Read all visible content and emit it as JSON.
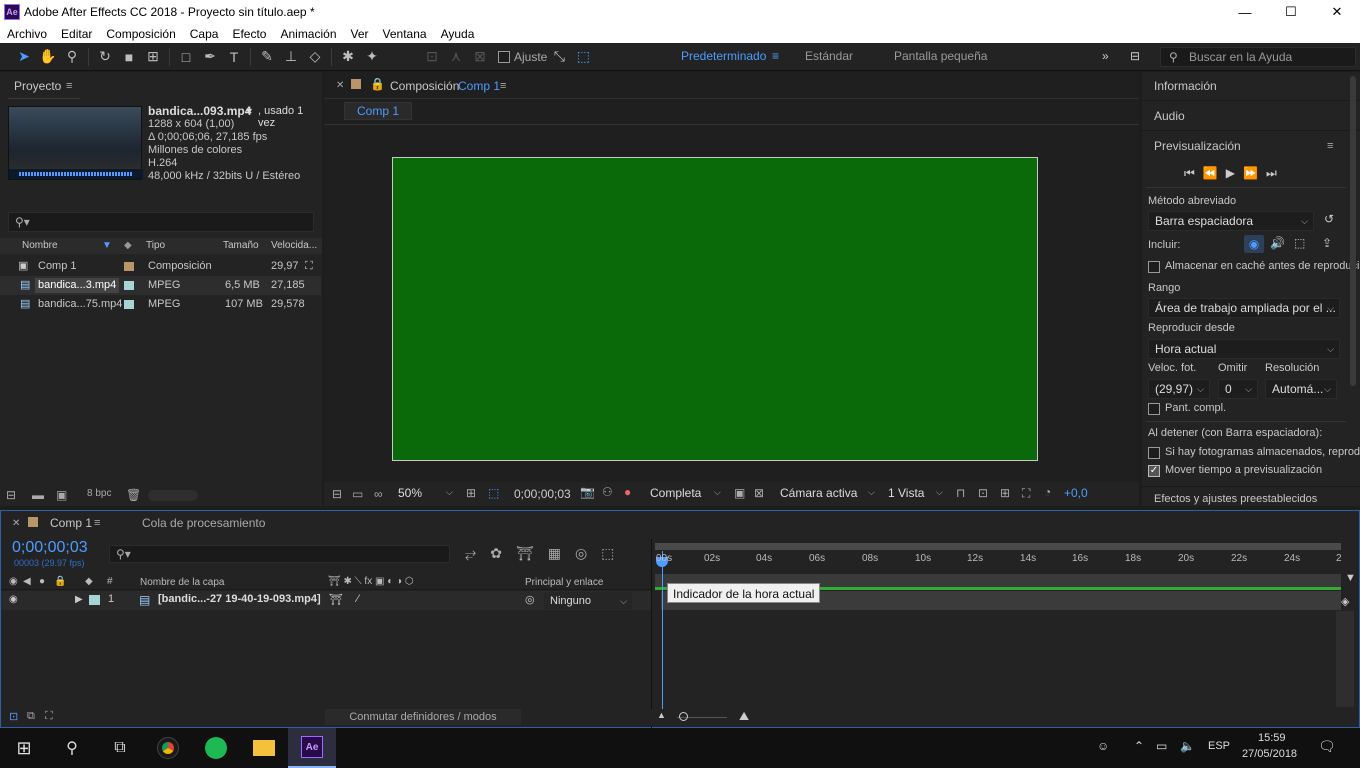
{
  "window": {
    "title": "Adobe After Effects CC 2018 - Proyecto sin título.aep *",
    "logo": "Ae",
    "minimize": "—",
    "maximize": "☐",
    "close": "✕"
  },
  "menu": [
    "Archivo",
    "Editar",
    "Composición",
    "Capa",
    "Efecto",
    "Animación",
    "Ver",
    "Ventana",
    "Ayuda"
  ],
  "toolbar": {
    "snap_label": "Ajuste",
    "workspaces": [
      "Predeterminado",
      "Estándar",
      "Pantalla pequeña"
    ],
    "help_placeholder": "Buscar en la Ayuda"
  },
  "project": {
    "title": "Proyecto",
    "footage": {
      "name": "bandica...093.mp4",
      "usage": ", usado 1 vez",
      "dims": "1288 x 604 (1,00)",
      "duration": "Δ 0;00;06;06, 27,185 fps",
      "colors": "Millones de colores",
      "codec": "H.264",
      "audio": "48,000 kHz / 32bits U / Estéreo"
    },
    "columns": [
      "Nombre",
      "Tipo",
      "Tamaño",
      "Velocida..."
    ],
    "items": [
      {
        "name": "Comp 1",
        "type": "Composición",
        "size": "",
        "rate": "29,97",
        "color": "#b99669"
      },
      {
        "name": "bandica...3.mp4",
        "type": "MPEG",
        "size": "6,5 MB",
        "rate": "27,185",
        "color": "#a7d4d4"
      },
      {
        "name": "bandica...75.mp4",
        "type": "MPEG",
        "size": "107 MB",
        "rate": "29,578",
        "color": "#a7d4d4"
      }
    ],
    "bpc": "8 bpc"
  },
  "composition": {
    "label": "Composición",
    "name": "Comp 1",
    "tab": "Comp 1",
    "canvas_color": "#0a6a0a",
    "zoom": "50%",
    "timecode": "0;00;00;03",
    "quality": "Completa",
    "camera": "Cámara activa",
    "views": "1 Vista",
    "exposure": "+0,0"
  },
  "right_panel": {
    "info": "Información",
    "audio": "Audio",
    "preview": "Previsualización",
    "shortcut_label": "Método abreviado",
    "shortcut_value": "Barra espaciadora",
    "include_label": "Incluir:",
    "cache_label": "Almacenar en caché antes de reproducir",
    "range_label": "Rango",
    "range_value": "Área de trabajo ampliada por el ...",
    "play_from_label": "Reproducir desde",
    "play_from_value": "Hora actual",
    "fps_label": "Veloc. fot.",
    "skip_label": "Omitir",
    "res_label": "Resolución",
    "fps_value": "(29,97)",
    "skip_value": "0",
    "res_value": "Automá...",
    "fullscreen_label": "Pant. compl.",
    "on_stop_label": "Al detener (con Barra espaciadora):",
    "cached_label": "Si hay fotogramas almacenados, reproducir",
    "move_time_label": "Mover tiempo a previsualización",
    "effects_label": "Efectos y ajustes preestablecidos"
  },
  "timeline": {
    "tab": "Comp 1",
    "render_queue": "Cola de procesamiento",
    "timecode": "0;00;00;03",
    "frame_info": "00003 (29.97 fps)",
    "col_hash": "#",
    "col_name": "Nombre de la capa",
    "col_parent": "Principal y enlace",
    "layer": {
      "index": "1",
      "name": "[bandic...-27 19-40-19-093.mp4]",
      "parent": "Ninguno",
      "color": "#a7d4d4"
    },
    "ticks": [
      "00s",
      "02s",
      "04s",
      "06s",
      "08s",
      "10s",
      "12s",
      "14s",
      "16s",
      "18s",
      "20s",
      "22s",
      "24s",
      "2"
    ],
    "tooltip": "Indicador de la hora actual",
    "switches_label": "Conmutar definidores / modos"
  },
  "taskbar": {
    "language": "ESP",
    "time": "15:59",
    "date": "27/05/2018"
  }
}
